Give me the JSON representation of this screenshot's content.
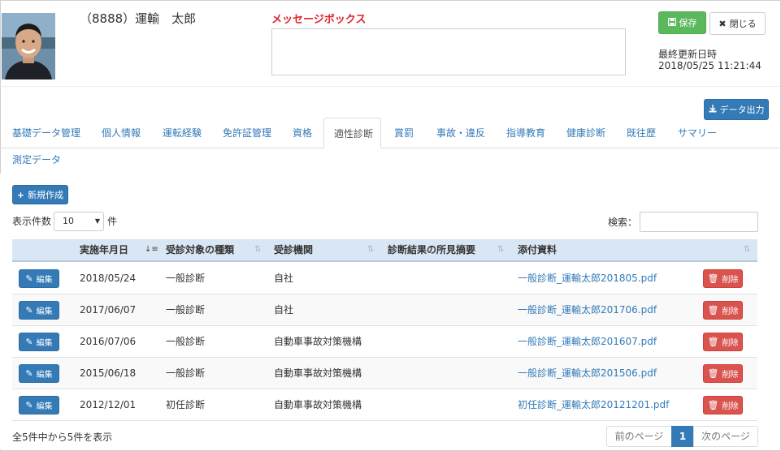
{
  "header": {
    "user_name": "（8888）運輸　太郎",
    "message_box_label": "メッセージボックス",
    "save_label": "保存",
    "close_label": "閉じる",
    "last_updated_label": "最終更新日時",
    "last_updated_value": "2018/05/25 11:21:44",
    "export_label": "データ出力"
  },
  "tabs": [
    {
      "label": "基礎データ管理"
    },
    {
      "label": "個人情報"
    },
    {
      "label": "運転経験"
    },
    {
      "label": "免許証管理"
    },
    {
      "label": "資格"
    },
    {
      "label": "適性診断",
      "active": true
    },
    {
      "label": "賞罰"
    },
    {
      "label": "事故・違反"
    },
    {
      "label": "指導教育"
    },
    {
      "label": "健康診断"
    },
    {
      "label": "既往歴"
    },
    {
      "label": "サマリー"
    },
    {
      "label": "測定データ"
    }
  ],
  "toolbar": {
    "new_label": "新規作成",
    "length_label": "表示件数",
    "length_value": "10",
    "length_suffix": "件",
    "search_label": "検索："
  },
  "table": {
    "headers": [
      "実施年月日",
      "受診対象の種類",
      "受診機関",
      "診断結果の所見摘要",
      "添付資料"
    ],
    "edit_label": "編集",
    "delete_label": "削除",
    "rows": [
      {
        "date": "2018/05/24",
        "type": "一般診断",
        "institution": "自社",
        "summary": "",
        "attachment": "一般診断_運輸太郎201805.pdf"
      },
      {
        "date": "2017/06/07",
        "type": "一般診断",
        "institution": "自社",
        "summary": "",
        "attachment": "一般診断_運輸太郎201706.pdf"
      },
      {
        "date": "2016/07/06",
        "type": "一般診断",
        "institution": "自動車事故対策機構",
        "summary": "",
        "attachment": "一般診断_運輸太郎201607.pdf"
      },
      {
        "date": "2015/06/18",
        "type": "一般診断",
        "institution": "自動車事故対策機構",
        "summary": "",
        "attachment": "一般診断_運輸太郎201506.pdf"
      },
      {
        "date": "2012/12/01",
        "type": "初任診断",
        "institution": "自動車事故対策機構",
        "summary": "",
        "attachment": "初任診断_運輸太郎20121201.pdf"
      }
    ]
  },
  "footer": {
    "info": "全5件中から5件を表示",
    "prev_label": "前のページ",
    "current_page": "1",
    "next_label": "次のページ"
  },
  "colors": {
    "primary": "#337ab7",
    "success": "#5cb85c",
    "danger": "#d9534f",
    "message_label": "#e0202a",
    "table_header_bg": "#d9e6f3"
  },
  "icons": {
    "save": "floppy-disk-icon",
    "close": "close-icon",
    "export": "download-icon",
    "new": "plus-icon",
    "edit": "edit-icon",
    "delete": "trash-icon"
  }
}
